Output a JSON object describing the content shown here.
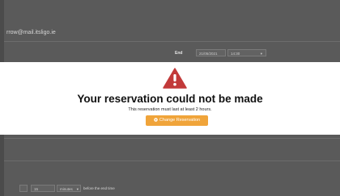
{
  "background": {
    "email": "rrow@mail.itsligo.ie",
    "end_label": "End",
    "end_date": "21/05/2021",
    "end_time": "14:30",
    "time_caret": "▾",
    "reminder_value": "15",
    "reminder_unit": "minutes",
    "unit_caret": "▾",
    "reminder_hint": "before the end time"
  },
  "modal": {
    "icon": "warning-triangle-icon",
    "title": "Your reservation could not be made",
    "message": "This reservation must last at least 2 hours.",
    "button_icon": "gear-icon",
    "button_label": "Change Reservation"
  },
  "colors": {
    "accent": "#f0a43a",
    "warning": "#c23a3a",
    "backdrop": "#4b4b4b"
  }
}
